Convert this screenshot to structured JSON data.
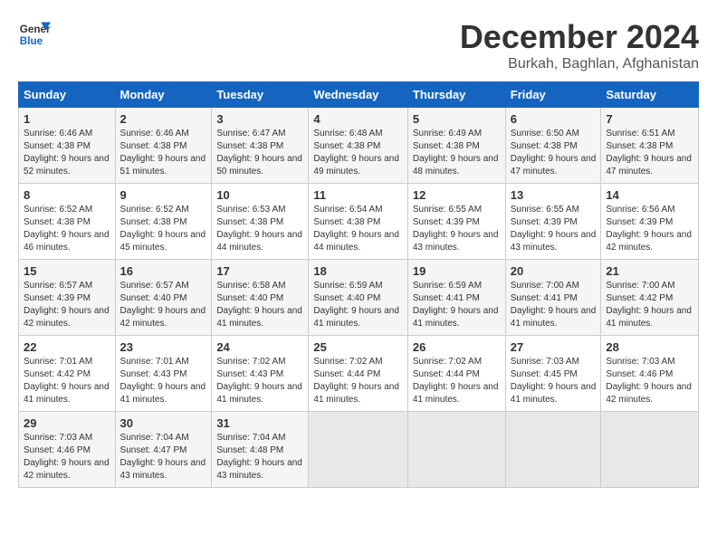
{
  "logo": {
    "line1": "General",
    "line2": "Blue"
  },
  "title": "December 2024",
  "location": "Burkah, Baghlan, Afghanistan",
  "headers": [
    "Sunday",
    "Monday",
    "Tuesday",
    "Wednesday",
    "Thursday",
    "Friday",
    "Saturday"
  ],
  "weeks": [
    [
      {
        "day": "1",
        "sunrise": "6:46 AM",
        "sunset": "4:38 PM",
        "daylight": "9 hours and 52 minutes."
      },
      {
        "day": "2",
        "sunrise": "6:46 AM",
        "sunset": "4:38 PM",
        "daylight": "9 hours and 51 minutes."
      },
      {
        "day": "3",
        "sunrise": "6:47 AM",
        "sunset": "4:38 PM",
        "daylight": "9 hours and 50 minutes."
      },
      {
        "day": "4",
        "sunrise": "6:48 AM",
        "sunset": "4:38 PM",
        "daylight": "9 hours and 49 minutes."
      },
      {
        "day": "5",
        "sunrise": "6:49 AM",
        "sunset": "4:38 PM",
        "daylight": "9 hours and 48 minutes."
      },
      {
        "day": "6",
        "sunrise": "6:50 AM",
        "sunset": "4:38 PM",
        "daylight": "9 hours and 47 minutes."
      },
      {
        "day": "7",
        "sunrise": "6:51 AM",
        "sunset": "4:38 PM",
        "daylight": "9 hours and 47 minutes."
      }
    ],
    [
      {
        "day": "8",
        "sunrise": "6:52 AM",
        "sunset": "4:38 PM",
        "daylight": "9 hours and 46 minutes."
      },
      {
        "day": "9",
        "sunrise": "6:52 AM",
        "sunset": "4:38 PM",
        "daylight": "9 hours and 45 minutes."
      },
      {
        "day": "10",
        "sunrise": "6:53 AM",
        "sunset": "4:38 PM",
        "daylight": "9 hours and 44 minutes."
      },
      {
        "day": "11",
        "sunrise": "6:54 AM",
        "sunset": "4:38 PM",
        "daylight": "9 hours and 44 minutes."
      },
      {
        "day": "12",
        "sunrise": "6:55 AM",
        "sunset": "4:39 PM",
        "daylight": "9 hours and 43 minutes."
      },
      {
        "day": "13",
        "sunrise": "6:55 AM",
        "sunset": "4:39 PM",
        "daylight": "9 hours and 43 minutes."
      },
      {
        "day": "14",
        "sunrise": "6:56 AM",
        "sunset": "4:39 PM",
        "daylight": "9 hours and 42 minutes."
      }
    ],
    [
      {
        "day": "15",
        "sunrise": "6:57 AM",
        "sunset": "4:39 PM",
        "daylight": "9 hours and 42 minutes."
      },
      {
        "day": "16",
        "sunrise": "6:57 AM",
        "sunset": "4:40 PM",
        "daylight": "9 hours and 42 minutes."
      },
      {
        "day": "17",
        "sunrise": "6:58 AM",
        "sunset": "4:40 PM",
        "daylight": "9 hours and 41 minutes."
      },
      {
        "day": "18",
        "sunrise": "6:59 AM",
        "sunset": "4:40 PM",
        "daylight": "9 hours and 41 minutes."
      },
      {
        "day": "19",
        "sunrise": "6:59 AM",
        "sunset": "4:41 PM",
        "daylight": "9 hours and 41 minutes."
      },
      {
        "day": "20",
        "sunrise": "7:00 AM",
        "sunset": "4:41 PM",
        "daylight": "9 hours and 41 minutes."
      },
      {
        "day": "21",
        "sunrise": "7:00 AM",
        "sunset": "4:42 PM",
        "daylight": "9 hours and 41 minutes."
      }
    ],
    [
      {
        "day": "22",
        "sunrise": "7:01 AM",
        "sunset": "4:42 PM",
        "daylight": "9 hours and 41 minutes."
      },
      {
        "day": "23",
        "sunrise": "7:01 AM",
        "sunset": "4:43 PM",
        "daylight": "9 hours and 41 minutes."
      },
      {
        "day": "24",
        "sunrise": "7:02 AM",
        "sunset": "4:43 PM",
        "daylight": "9 hours and 41 minutes."
      },
      {
        "day": "25",
        "sunrise": "7:02 AM",
        "sunset": "4:44 PM",
        "daylight": "9 hours and 41 minutes."
      },
      {
        "day": "26",
        "sunrise": "7:02 AM",
        "sunset": "4:44 PM",
        "daylight": "9 hours and 41 minutes."
      },
      {
        "day": "27",
        "sunrise": "7:03 AM",
        "sunset": "4:45 PM",
        "daylight": "9 hours and 41 minutes."
      },
      {
        "day": "28",
        "sunrise": "7:03 AM",
        "sunset": "4:46 PM",
        "daylight": "9 hours and 42 minutes."
      }
    ],
    [
      {
        "day": "29",
        "sunrise": "7:03 AM",
        "sunset": "4:46 PM",
        "daylight": "9 hours and 42 minutes."
      },
      {
        "day": "30",
        "sunrise": "7:04 AM",
        "sunset": "4:47 PM",
        "daylight": "9 hours and 43 minutes."
      },
      {
        "day": "31",
        "sunrise": "7:04 AM",
        "sunset": "4:48 PM",
        "daylight": "9 hours and 43 minutes."
      },
      null,
      null,
      null,
      null
    ]
  ]
}
